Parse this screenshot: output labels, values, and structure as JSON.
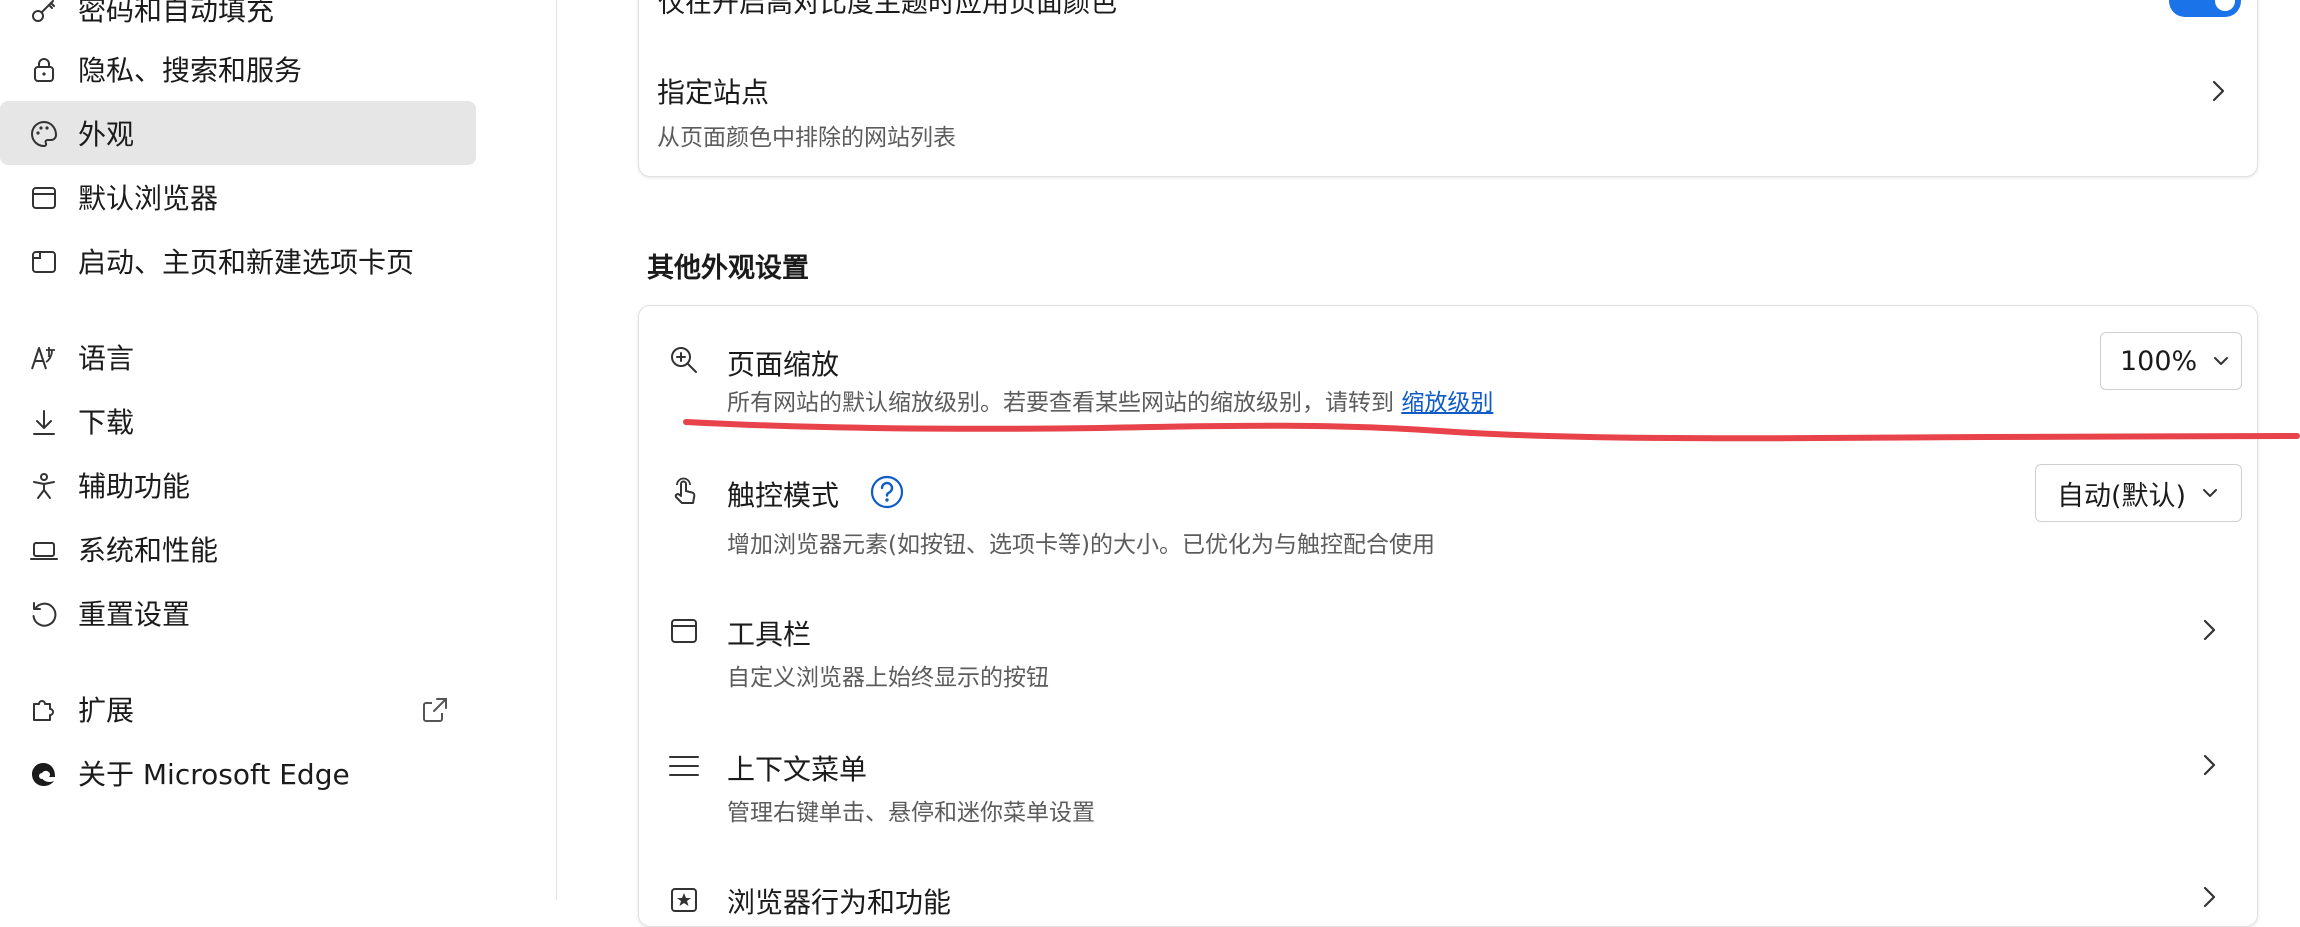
{
  "sidebar": {
    "items": [
      {
        "label": "密码和自动填充",
        "icon": "key-icon"
      },
      {
        "label": "隐私、搜索和服务",
        "icon": "lock-icon"
      },
      {
        "label": "外观",
        "icon": "palette-icon",
        "active": true
      },
      {
        "label": "默认浏览器",
        "icon": "browser-icon"
      },
      {
        "label": "启动、主页和新建选项卡页",
        "icon": "tab-page-icon"
      },
      {
        "label": "语言",
        "icon": "language-icon"
      },
      {
        "label": "下载",
        "icon": "download-icon"
      },
      {
        "label": "辅助功能",
        "icon": "accessibility-icon"
      },
      {
        "label": "系统和性能",
        "icon": "laptop-icon"
      },
      {
        "label": "重置设置",
        "icon": "reset-icon"
      },
      {
        "label": "扩展",
        "icon": "puzzle-icon"
      },
      {
        "label": "关于 Microsoft Edge",
        "icon": "edge-logo-icon"
      }
    ],
    "external_link_icon": "external-link-icon"
  },
  "main": {
    "top_card": {
      "partial_text": "仅在开启高对比度主题时应用页面颜色",
      "toggle_on": true,
      "sites": {
        "title": "指定站点",
        "desc": "从页面颜色中排除的网站列表"
      }
    },
    "section_title": "其他外观设置",
    "rows": {
      "zoom": {
        "title": "页面缩放",
        "desc": "所有网站的默认缩放级别。若要查看某些网站的缩放级别，请转到",
        "link": "缩放级别",
        "value": "100%"
      },
      "touch": {
        "title": "触控模式",
        "desc": "增加浏览器元素(如按钮、选项卡等)的大小。已优化为与触控配合使用",
        "value": "自动(默认)"
      },
      "toolbar": {
        "title": "工具栏",
        "desc": "自定义浏览器上始终显示的按钮"
      },
      "context_menu": {
        "title": "上下文菜单",
        "desc": "管理右键单击、悬停和迷你菜单设置"
      },
      "browser_behavior": {
        "title": "浏览器行为和功能"
      }
    }
  },
  "colors": {
    "accent": "#1a73e8",
    "link": "#0f5cc7",
    "annotation": "#e8424a",
    "active_bg": "#e6e6e6"
  }
}
